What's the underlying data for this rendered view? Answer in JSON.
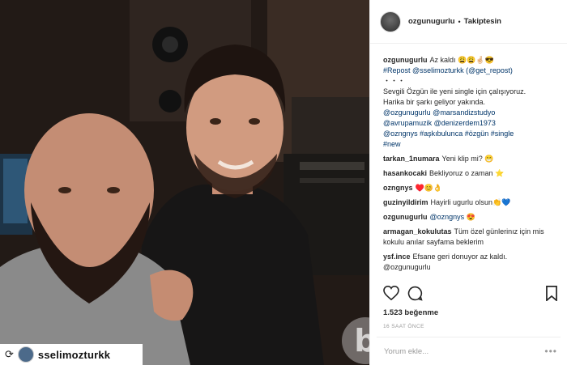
{
  "post": {
    "author": "ozgunugurlu",
    "follow_status": "Takiptesin",
    "separator": "•",
    "repost_tag": {
      "username": "sselimozturkk",
      "icon": "repost-icon"
    },
    "likes": "1.523 beğenme",
    "time_ago": "16 SAAT ÖNCE",
    "comment_placeholder": "Yorum ekle...",
    "more_options": "•••",
    "watermark_letter": "b"
  },
  "caption": {
    "user": "ozgunugurlu",
    "line1": "Az kaldı 😩😩🤞🏻😎",
    "line2": "#Repost @sselimozturkk (@get_repost)",
    "line3": "・・・",
    "line4": "Sevgili Özgün ile yeni single için çalışıyoruz.",
    "line5": "Harika bir şarkı geliyor yakında.",
    "line6": "@ozgunugurlu @marsandizstudyo",
    "line7": "@avrupamuzik @denizerdem1973",
    "line8": "@ozngnys #aşkıbulunca #özgün #single",
    "line9": "#new"
  },
  "comments": [
    {
      "user": "tarkan_1numara",
      "text": "Yeni klip mi? 😁"
    },
    {
      "user": "hasankocaki",
      "text": "Bekliyoruz o zaman ⭐"
    },
    {
      "user": "ozngnys",
      "text": "♥️😊👌"
    },
    {
      "user": "guzinyildirim",
      "text": "Hayirli ugurlu olsun👏💙"
    },
    {
      "user": "ozgunugurlu",
      "text": "@ozngnys 😍"
    },
    {
      "user": "armagan_kokulutas",
      "text": "Tüm özel günlerinız için mis kokulu anılar sayfama beklerim"
    },
    {
      "user": "ysf.ince",
      "text": "Efsane geri donuyor az kaldı. @ozgunugurlu"
    }
  ],
  "icons": [
    "heart-icon",
    "comment-icon",
    "bookmark-icon"
  ]
}
